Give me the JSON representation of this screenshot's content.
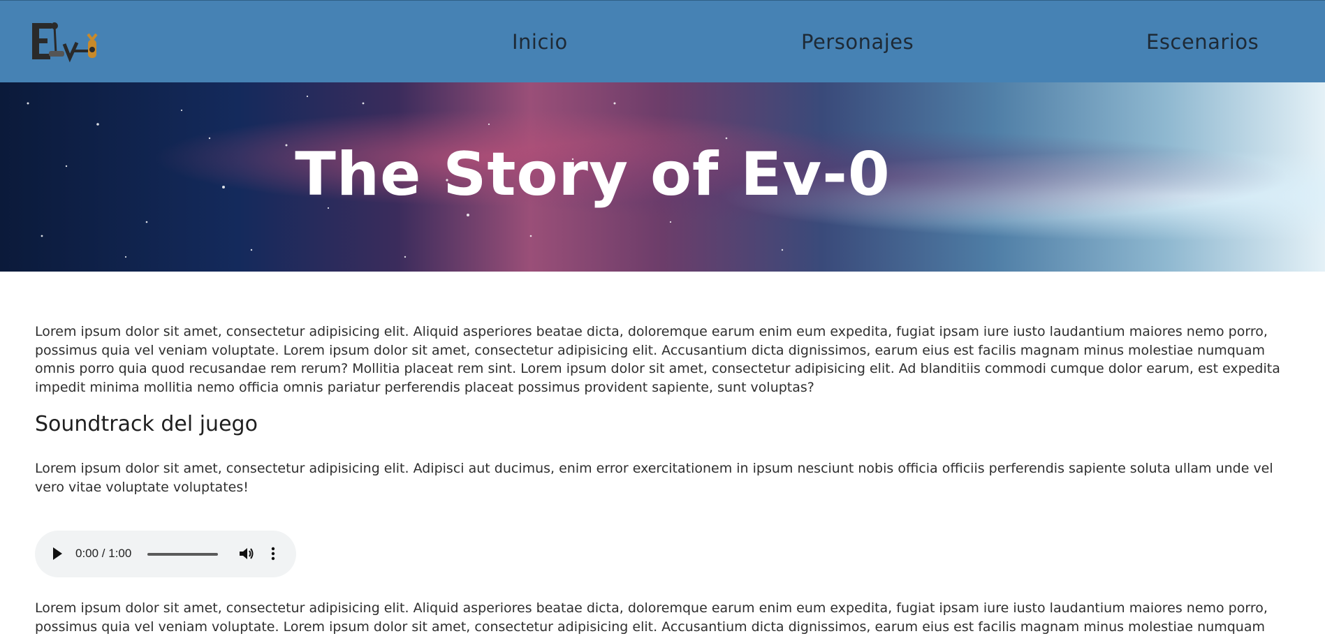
{
  "nav": {
    "logo_alt": "Ev-0",
    "links": [
      "Inicio",
      "Personajes",
      "Escenarios"
    ]
  },
  "hero": {
    "title": "The Story of Ev-0"
  },
  "content": {
    "paragraph1": "Lorem ipsum dolor sit amet, consectetur adipisicing elit. Aliquid asperiores beatae dicta, doloremque earum enim eum expedita, fugiat ipsam iure iusto laudantium maiores nemo porro, possimus quia vel veniam voluptate. Lorem ipsum dolor sit amet, consectetur adipisicing elit. Accusantium dicta dignissimos, earum eius est facilis magnam minus molestiae numquam omnis porro quia quod recusandae rem rerum? Mollitia placeat rem sint. Lorem ipsum dolor sit amet, consectetur adipisicing elit. Ad blanditiis commodi cumque dolor earum, est expedita impedit minima mollitia nemo officia omnis pariatur perferendis placeat possimus provident sapiente, sunt voluptas?",
    "soundtrack_title": "Soundtrack del juego",
    "paragraph2": "Lorem ipsum dolor sit amet, consectetur adipisicing elit. Adipisci aut ducimus, enim error exercitationem in ipsum nesciunt nobis officia officiis perferendis sapiente soluta ullam unde vel vero vitae voluptate voluptates!",
    "audio_time": "0:00 / 1:00",
    "paragraph3": "Lorem ipsum dolor sit amet, consectetur adipisicing elit. Aliquid asperiores beatae dicta, doloremque earum enim eum expedita, fugiat ipsam iure iusto laudantium maiores nemo porro, possimus quia vel veniam voluptate. Lorem ipsum dolor sit amet, consectetur adipisicing elit. Accusantium dicta dignissimos, earum eius est facilis magnam minus molestiae numquam"
  },
  "colors": {
    "navbar": "#4682b4",
    "nav_text": "#1e2a36",
    "hero_title": "#ffffff"
  }
}
